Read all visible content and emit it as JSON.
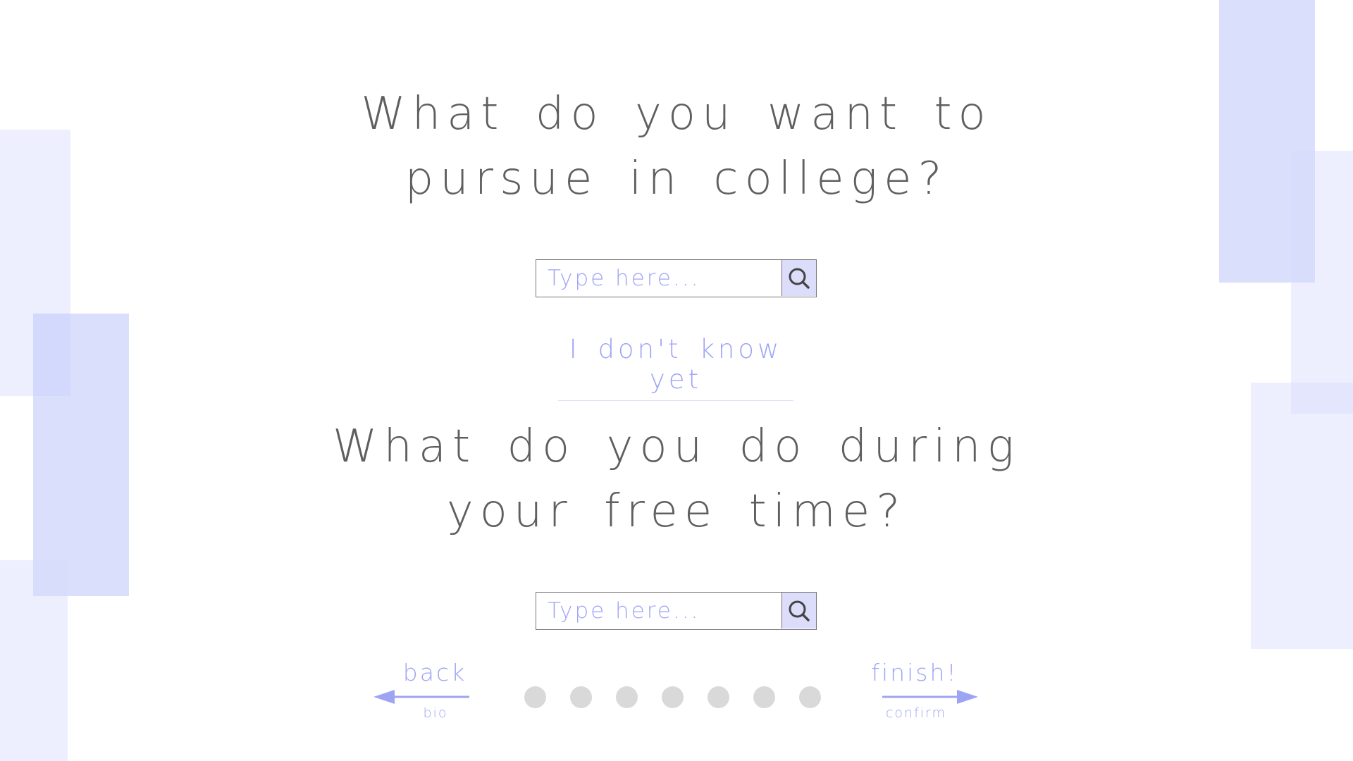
{
  "colors": {
    "accent": "#9ea4f4",
    "question_text": "#5f5f5f",
    "search_button_bg": "#dcdcfb",
    "dot": "#d9d9d9",
    "decoration": "#d6dbfc"
  },
  "questions": [
    {
      "line1": "What do you want to",
      "line2": "pursue in college?",
      "input": {
        "value": "",
        "placeholder": "Type here..."
      },
      "search_icon": "search-icon"
    },
    {
      "line1": "What do you do during",
      "line2": "your free time?",
      "input": {
        "value": "",
        "placeholder": "Type here..."
      },
      "search_icon": "search-icon"
    }
  ],
  "dont_know_label": "I don't know yet",
  "nav": {
    "back": {
      "label": "back",
      "sublabel": "bio",
      "icon": "arrow-left-icon"
    },
    "finish": {
      "label": "finish!",
      "sublabel": "confirm",
      "icon": "arrow-right-icon"
    },
    "step_count": 7
  }
}
